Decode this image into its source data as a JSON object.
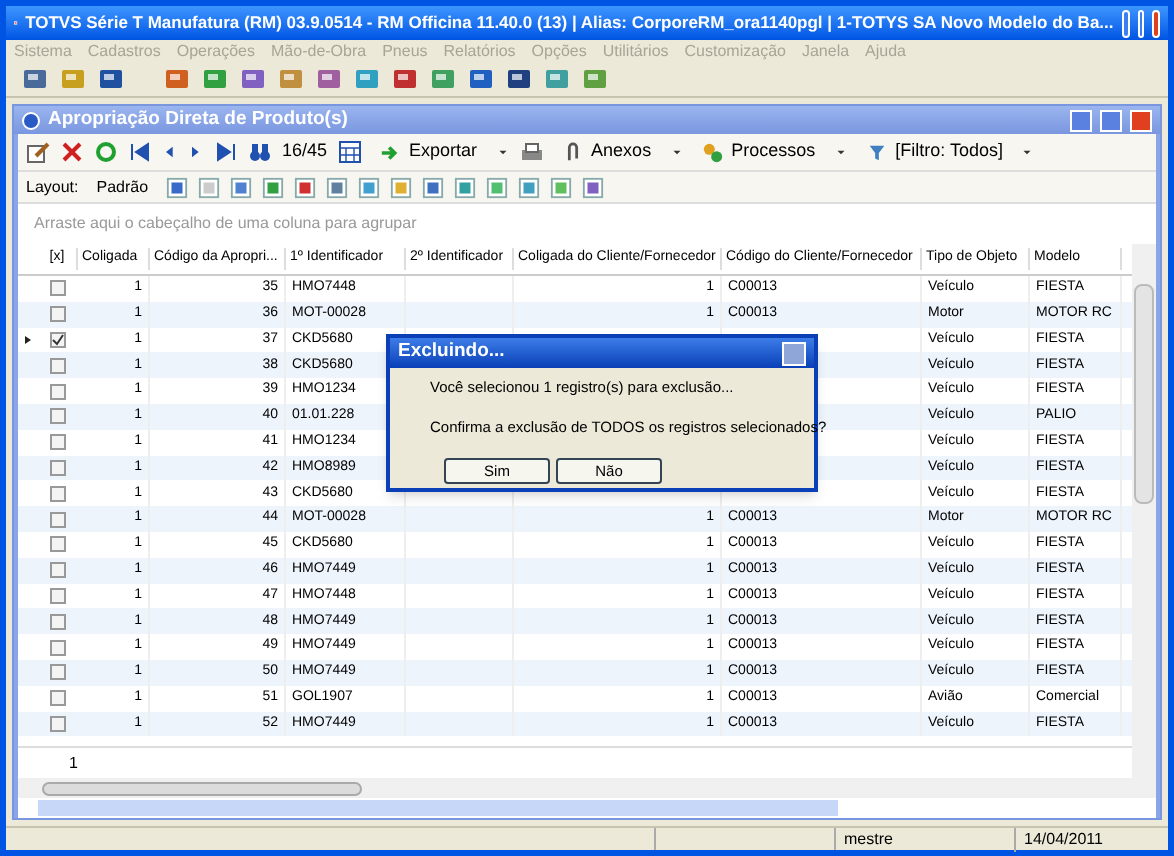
{
  "window": {
    "title": "TOTVS Série T Manufatura (RM) 03.9.0514 - RM Officina 11.40.0 (13) | Alias: CorporeRM_ora1140pgl | 1-TOTYS SA Novo Modelo do Ba..."
  },
  "menu": [
    {
      "label": "Sistema",
      "disabled": true
    },
    {
      "label": "Cadastros",
      "disabled": true
    },
    {
      "label": "Operações",
      "disabled": true
    },
    {
      "label": "Mão-de-Obra",
      "disabled": true
    },
    {
      "label": "Pneus",
      "disabled": true
    },
    {
      "label": "Relatórios",
      "disabled": true
    },
    {
      "label": "Opções",
      "disabled": true
    },
    {
      "label": "Utilitários",
      "disabled": true
    },
    {
      "label": "Customização",
      "disabled": true
    },
    {
      "label": "Janela",
      "disabled": true
    },
    {
      "label": "Ajuda",
      "disabled": true
    }
  ],
  "child_window": {
    "title": "Apropriação Direta de Produto(s)"
  },
  "toolbar": {
    "record_position": "16/45",
    "export": "Exportar",
    "attachments": "Anexos",
    "processes": "Processos",
    "filter": "[Filtro: Todos]"
  },
  "layout_bar": {
    "label": "Layout:",
    "layout": "Padrão"
  },
  "group_hint": "Arraste aqui o cabeçalho de uma coluna para agrupar",
  "table": {
    "columns": [
      "[x]",
      "Coligada",
      "Código da Apropri...",
      "1º Identificador",
      "2º Identificador",
      "Coligada do Cliente/Fornecedor",
      "Código do Cliente/Fornecedor",
      "Tipo de Objeto",
      "Modelo"
    ],
    "rows": [
      {
        "current": false,
        "checked": false,
        "coligada": "1",
        "codigo": "35",
        "id1": "HMO7448",
        "coligada_cliente": "1",
        "codigo_cliente": "C00013",
        "tipo": "Veículo",
        "modelo": "FIESTA"
      },
      {
        "current": false,
        "checked": false,
        "coligada": "1",
        "codigo": "36",
        "id1": "MOT-00028",
        "coligada_cliente": "1",
        "codigo_cliente": "C00013",
        "tipo": "Motor",
        "modelo": "MOTOR RC"
      },
      {
        "current": true,
        "checked": true,
        "coligada": "1",
        "codigo": "37",
        "id1": "CKD5680",
        "tipo": "Veículo",
        "modelo": "FIESTA"
      },
      {
        "current": false,
        "checked": false,
        "coligada": "1",
        "codigo": "38",
        "id1": "CKD5680",
        "tipo": "Veículo",
        "modelo": "FIESTA"
      },
      {
        "current": false,
        "checked": false,
        "coligada": "1",
        "codigo": "39",
        "id1": "HMO1234",
        "tipo": "Veículo",
        "modelo": "FIESTA"
      },
      {
        "current": false,
        "checked": false,
        "coligada": "1",
        "codigo": "40",
        "id1": "01.01.228",
        "tipo": "Veículo",
        "modelo": "PALIO"
      },
      {
        "current": false,
        "checked": false,
        "coligada": "1",
        "codigo": "41",
        "id1": "HMO1234",
        "tipo": "Veículo",
        "modelo": "FIESTA"
      },
      {
        "current": false,
        "checked": false,
        "coligada": "1",
        "codigo": "42",
        "id1": "HMO8989",
        "tipo": "Veículo",
        "modelo": "FIESTA"
      },
      {
        "current": false,
        "checked": false,
        "coligada": "1",
        "codigo": "43",
        "id1": "CKD5680",
        "tipo": "Veículo",
        "modelo": "FIESTA"
      },
      {
        "current": false,
        "checked": false,
        "coligada": "1",
        "codigo": "44",
        "id1": "MOT-00028",
        "coligada_cliente": "1",
        "codigo_cliente": "C00013",
        "tipo": "Motor",
        "modelo": "MOTOR RC"
      },
      {
        "current": false,
        "checked": false,
        "coligada": "1",
        "codigo": "45",
        "id1": "CKD5680",
        "coligada_cliente": "1",
        "codigo_cliente": "C00013",
        "tipo": "Veículo",
        "modelo": "FIESTA"
      },
      {
        "current": false,
        "checked": false,
        "coligada": "1",
        "codigo": "46",
        "id1": "HMO7449",
        "coligada_cliente": "1",
        "codigo_cliente": "C00013",
        "tipo": "Veículo",
        "modelo": "FIESTA"
      },
      {
        "current": false,
        "checked": false,
        "coligada": "1",
        "codigo": "47",
        "id1": "HMO7448",
        "coligada_cliente": "1",
        "codigo_cliente": "C00013",
        "tipo": "Veículo",
        "modelo": "FIESTA"
      },
      {
        "current": false,
        "checked": false,
        "coligada": "1",
        "codigo": "48",
        "id1": "HMO7449",
        "coligada_cliente": "1",
        "codigo_cliente": "C00013",
        "tipo": "Veículo",
        "modelo": "FIESTA"
      },
      {
        "current": false,
        "checked": false,
        "coligada": "1",
        "codigo": "49",
        "id1": "HMO7449",
        "coligada_cliente": "1",
        "codigo_cliente": "C00013",
        "tipo": "Veículo",
        "modelo": "FIESTA"
      },
      {
        "current": false,
        "checked": false,
        "coligada": "1",
        "codigo": "50",
        "id1": "HMO7449",
        "coligada_cliente": "1",
        "codigo_cliente": "C00013",
        "tipo": "Veículo",
        "modelo": "FIESTA"
      },
      {
        "current": false,
        "checked": false,
        "coligada": "1",
        "codigo": "51",
        "id1": "GOL1907",
        "coligada_cliente": "1",
        "codigo_cliente": "C00013",
        "tipo": "Avião",
        "modelo": "Comercial"
      },
      {
        "current": false,
        "checked": false,
        "coligada": "1",
        "codigo": "52",
        "id1": "HMO7449",
        "coligada_cliente": "1",
        "codigo_cliente": "C00013",
        "tipo": "Veículo",
        "modelo": "FIESTA"
      }
    ],
    "footer_count": "1"
  },
  "dialog": {
    "title": "Excluindo...",
    "lines": [
      "Você selecionou 1 registro(s) para exclusão...",
      "Confirma a exclusão de TODOS os registros selecionados?"
    ],
    "buttons": [
      "Sim",
      "Não"
    ]
  },
  "status_bar": {
    "user": "mestre",
    "date": "14/04/2011"
  }
}
